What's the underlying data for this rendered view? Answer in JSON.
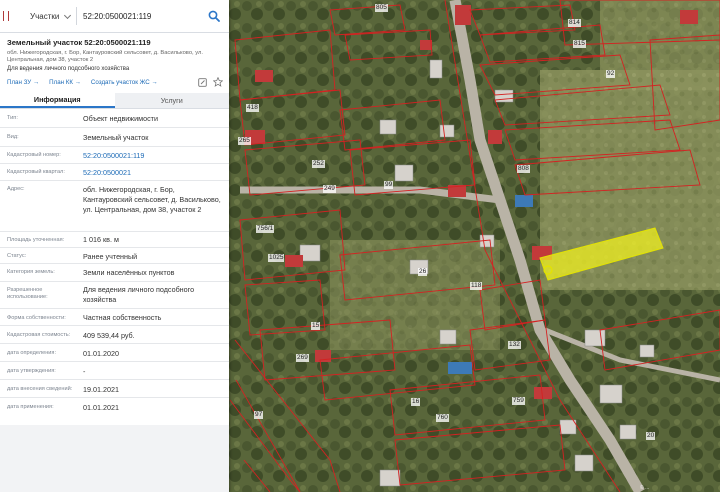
{
  "search": {
    "type_label": "Участки",
    "query": "52:20:0500021:119"
  },
  "object": {
    "title": "Земельный участок 52:20:0500021:119",
    "address": "обл. Нижегородская, г. Бор, Кантауровский сельсовет, д. Васильково, ул. Центральная, дом 38, участок 2",
    "permitted_use": "Для ведения личного подсобного хозяйства",
    "links": [
      "План ЗУ →",
      "План КК →",
      "Создать участок ЖС →"
    ]
  },
  "tabs": [
    "Информация",
    "Услуги"
  ],
  "fields": [
    {
      "label": "Тип:",
      "value": "Объект недвижимости",
      "link": false
    },
    {
      "label": "Вид:",
      "value": "Земельный участок",
      "link": false
    },
    {
      "label": "Кадастровый номер:",
      "value": "52:20:0500021:119",
      "link": true
    },
    {
      "label": "Кадастровый квартал:",
      "value": "52:20:0500021",
      "link": true
    },
    {
      "label": "Адрес:",
      "value": "обл. Нижегородская, г. Бор, Кантауровский сельсовет, д. Васильково, ул. Центральная, дом 38, участок 2",
      "link": false
    },
    {
      "label": "Площадь уточненная:",
      "value": "1 016 кв. м",
      "link": false
    },
    {
      "label": "Статус:",
      "value": "Ранее учтенный",
      "link": false
    },
    {
      "label": "Категория земель:",
      "value": "Земли населённых пунктов",
      "link": false
    },
    {
      "label": "Разрешенное использование:",
      "value": "Для ведения личного подсобного хозяйства",
      "link": false
    },
    {
      "label": "Форма собственности:",
      "value": "Частная собственность",
      "link": false
    },
    {
      "label": "Кадастровая стоимость:",
      "value": "409 539,44 руб.",
      "link": false
    },
    {
      "label": "дата определения:",
      "value": "01.01.2020",
      "link": false
    },
    {
      "label": "дата утверждения:",
      "value": "-",
      "link": false
    },
    {
      "label": "дата внесения сведений:",
      "value": "19.01.2021",
      "link": false
    },
    {
      "label": "дата применения:",
      "value": "01.01.2021",
      "link": false
    }
  ],
  "map": {
    "parcel_labels": [
      {
        "text": "805",
        "red": false
      },
      {
        "text": "814",
        "red": false
      },
      {
        "text": "815",
        "red": false
      },
      {
        "text": "92",
        "red": false
      },
      {
        "text": "418",
        "red": false
      },
      {
        "text": "265",
        "red": false
      },
      {
        "text": "252",
        "red": false
      },
      {
        "text": "99",
        "red": false
      },
      {
        "text": "249",
        "red": false
      },
      {
        "text": "808",
        "red": false
      },
      {
        "text": "756/1",
        "red": false
      },
      {
        "text": "1025",
        "red": false
      },
      {
        "text": "26",
        "red": false
      },
      {
        "text": "118",
        "red": false
      },
      {
        "text": "15",
        "red": false
      },
      {
        "text": "269",
        "red": false
      },
      {
        "text": "132",
        "red": false
      },
      {
        "text": "16",
        "red": false
      },
      {
        "text": "760",
        "red": false
      },
      {
        "text": "759",
        "red": false
      },
      {
        "text": "97",
        "red": false
      },
      {
        "text": "20",
        "red": false
      }
    ],
    "colors": {
      "boundary": "#d42222",
      "selected_parcel": "#f2f21e",
      "road": "#b9b3a6"
    }
  }
}
